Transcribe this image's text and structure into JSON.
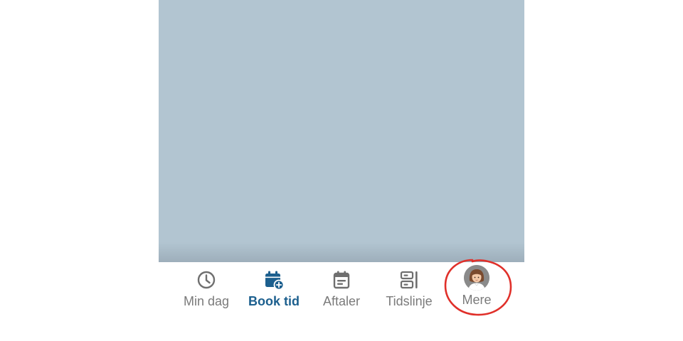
{
  "nav": {
    "tabs": [
      {
        "label": "Min dag",
        "icon": "clock-icon",
        "active": false
      },
      {
        "label": "Book tid",
        "icon": "calendar-add-icon",
        "active": true
      },
      {
        "label": "Aftaler",
        "icon": "calendar-list-icon",
        "active": false
      },
      {
        "label": "Tidslinje",
        "icon": "timeline-icon",
        "active": false
      },
      {
        "label": "Mere",
        "icon": "avatar",
        "active": false
      }
    ]
  },
  "colors": {
    "content_bg": "#b2c5d1",
    "active_tab": "#1c5f8e",
    "inactive_tab": "#7a7a7a",
    "annotation": "#e0302a"
  }
}
